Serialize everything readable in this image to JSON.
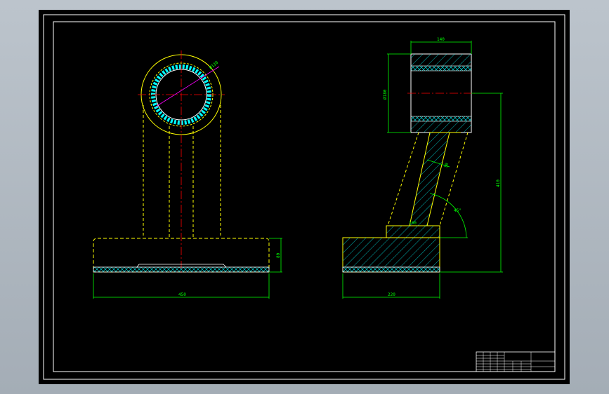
{
  "drawing": {
    "front_view": {
      "diameter_label": "Ø130",
      "base_width_label": "450",
      "base_height_label": "80"
    },
    "side_view": {
      "top_width_label": "140",
      "top_height_label": "Ø180",
      "web_thickness_label": "30",
      "angle_label": "45°",
      "total_height_label": "410",
      "base_width_label": "220",
      "web_base_label": "100"
    }
  },
  "colors": {
    "background": "#000000",
    "outline": "#ffff00",
    "centerline": "#ff0000",
    "dimension": "#00ff00",
    "hatch": "#00ffff",
    "frame": "#ffffff"
  }
}
